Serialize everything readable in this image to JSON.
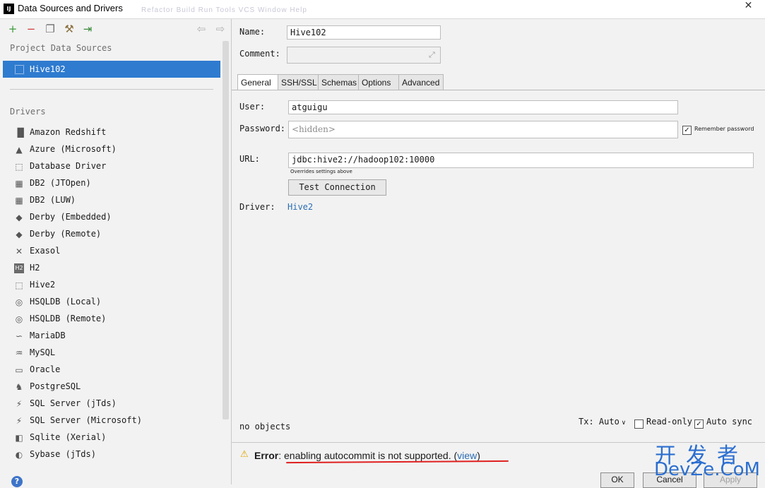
{
  "window": {
    "title": "Data Sources and Drivers",
    "app_icon": "IJ",
    "background_menu": "Refactor  Build  Run  Tools  VCS  Window  Help",
    "close_glyph": "✕"
  },
  "left": {
    "toolbar": [
      {
        "name": "add-icon",
        "glyph": "+",
        "color": "#3a9a3a"
      },
      {
        "name": "remove-icon",
        "glyph": "−",
        "color": "#d23a3a"
      },
      {
        "name": "duplicate-icon",
        "glyph": "❐",
        "color": "#6e6e6e"
      },
      {
        "name": "properties-icon",
        "glyph": "⚒",
        "color": "#8b6f3d"
      },
      {
        "name": "import-icon",
        "glyph": "⇥",
        "color": "#3a8a3a"
      },
      {
        "name": "back-icon",
        "glyph": "⇦",
        "color": "#b0b0b0"
      },
      {
        "name": "forward-icon",
        "glyph": "⇨",
        "color": "#b0b0b0"
      }
    ],
    "project_header": "Project Data Sources",
    "data_sources": [
      "Hive102"
    ],
    "drivers_header": "Drivers",
    "drivers": [
      {
        "label": "Amazon Redshift",
        "icon": "▐▌"
      },
      {
        "label": "Azure (Microsoft)",
        "icon": "▲"
      },
      {
        "label": "Database Driver",
        "icon": "⬚"
      },
      {
        "label": "DB2 (JTOpen)",
        "icon": "▦"
      },
      {
        "label": "DB2 (LUW)",
        "icon": "▦"
      },
      {
        "label": "Derby (Embedded)",
        "icon": "◆"
      },
      {
        "label": "Derby (Remote)",
        "icon": "◆"
      },
      {
        "label": "Exasol",
        "icon": "✕"
      },
      {
        "label": "H2",
        "icon": "H2"
      },
      {
        "label": "Hive2",
        "icon": "⬚"
      },
      {
        "label": "HSQLDB (Local)",
        "icon": "◎"
      },
      {
        "label": "HSQLDB (Remote)",
        "icon": "◎"
      },
      {
        "label": "MariaDB",
        "icon": "∽"
      },
      {
        "label": "MySQL",
        "icon": "♒"
      },
      {
        "label": "Oracle",
        "icon": "▭"
      },
      {
        "label": "PostgreSQL",
        "icon": "♞"
      },
      {
        "label": "SQL Server (jTds)",
        "icon": "⚡"
      },
      {
        "label": "SQL Server (Microsoft)",
        "icon": "⚡"
      },
      {
        "label": "Sqlite (Xerial)",
        "icon": "◧"
      },
      {
        "label": "Sybase (jTds)",
        "icon": "◐"
      }
    ],
    "help_glyph": "?"
  },
  "form": {
    "name_label": "Name:",
    "name_value": "Hive102",
    "comment_label": "Comment:",
    "comment_value": "",
    "tabs": [
      "General",
      "SSH/SSL",
      "Schemas",
      "Options",
      "Advanced"
    ],
    "active_tab": "General",
    "user_label": "User:",
    "user_value": "atguigu",
    "password_label": "Password:",
    "password_placeholder": "<hidden>",
    "remember_password_label": "Remember password",
    "remember_password_checked": true,
    "url_label": "URL:",
    "url_value": "jdbc:hive2://hadoop102:10000",
    "url_hint": "Overrides settings above",
    "test_connection_label": "Test Connection",
    "driver_label": "Driver:",
    "driver_value": "Hive2"
  },
  "status": {
    "objects_text": "no objects",
    "tx_label": "Tx: Auto",
    "readonly_label": "Read-only",
    "readonly_checked": false,
    "autosync_label": "Auto sync",
    "autosync_checked": true,
    "error_prefix": "Error",
    "error_message": "enabling autocommit is not supported.",
    "error_link": "view"
  },
  "buttons": {
    "ok": "OK",
    "cancel": "Cancel",
    "apply": "Apply"
  },
  "watermark": {
    "chinese": "开发者",
    "latin": "DevZe.CoM"
  },
  "colors": {
    "selection": "#2e7bcf",
    "link": "#2a6db3",
    "error_underline": "#e02020",
    "watermark": "#2c6fd0"
  }
}
